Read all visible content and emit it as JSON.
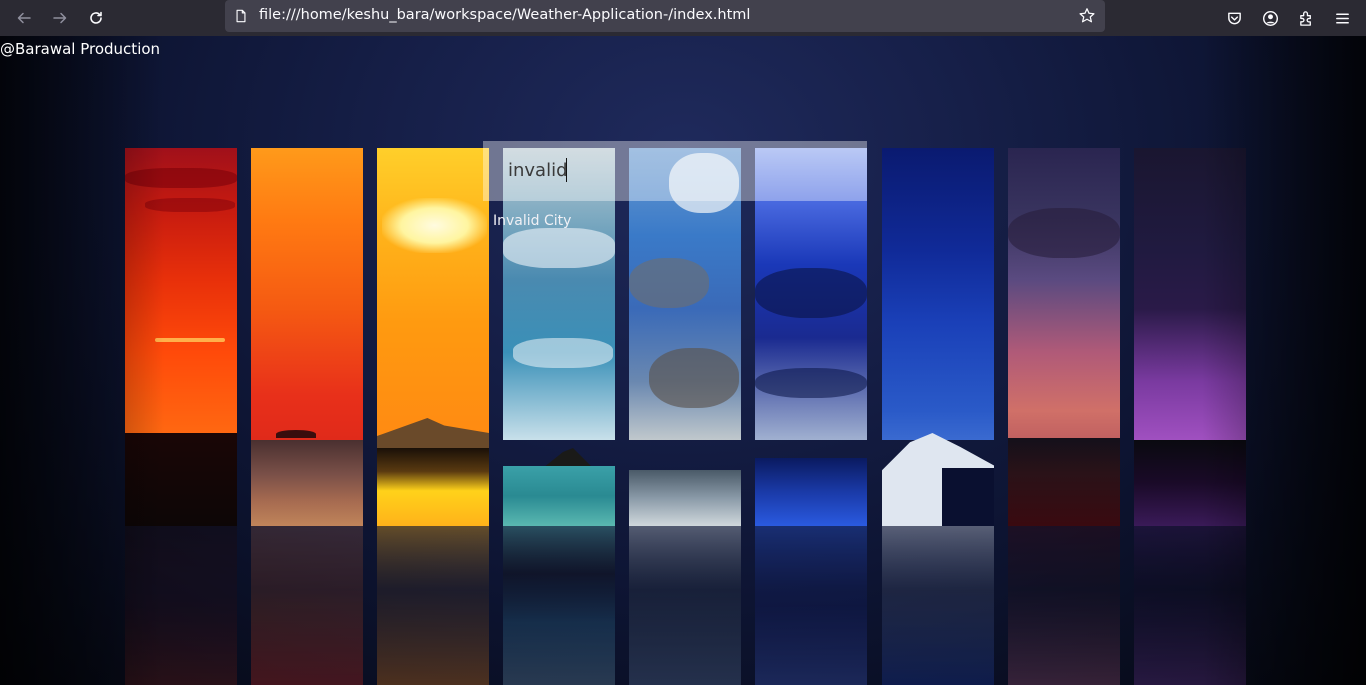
{
  "browser": {
    "url": "file:///home/keshu_bara/workspace/Weather-Application-/index.html",
    "icons": [
      "back-arrow-icon",
      "forward-arrow-icon",
      "reload-icon",
      "page-icon",
      "bookmark-star-icon",
      "pocket-icon",
      "account-icon",
      "extensions-icon",
      "menu-icon"
    ]
  },
  "page": {
    "credit": "@Barawal Production",
    "search": {
      "value": "invalid",
      "placeholder": ""
    },
    "error": "Invalid City"
  },
  "colors": {
    "toolbar": "#2b2a33",
    "urlbar": "#42414d",
    "background": "#0b1024"
  }
}
